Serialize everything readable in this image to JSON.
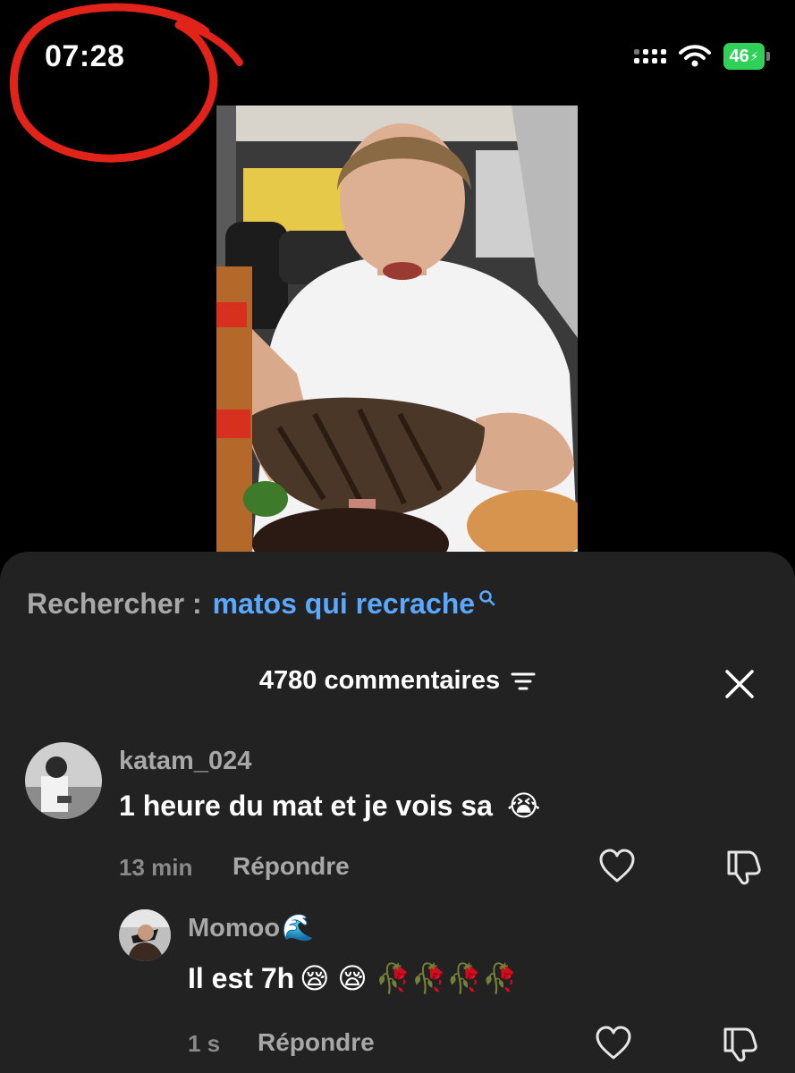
{
  "status_bar": {
    "time": "07:28",
    "battery": "46",
    "annotation_color": "#e2231a"
  },
  "video": {
    "icon": "video-frame"
  },
  "search": {
    "label": "Rechercher :",
    "query": "matos qui recrache",
    "query_color": "#5ba8ff"
  },
  "comments": {
    "title": "4780 commentaires",
    "items": [
      {
        "username": "katam_024",
        "text": "1 heure du mat et je vois sa",
        "emoji": "😭",
        "time": "13 min",
        "reply_label": "Répondre",
        "replies": [
          {
            "username": "Momoo",
            "username_emoji": "🌊",
            "text": "Il est 7h",
            "emojis": "😪 😪 🥀🥀🥀🥀",
            "time": "1 s",
            "reply_label": "Répondre"
          }
        ]
      }
    ]
  }
}
